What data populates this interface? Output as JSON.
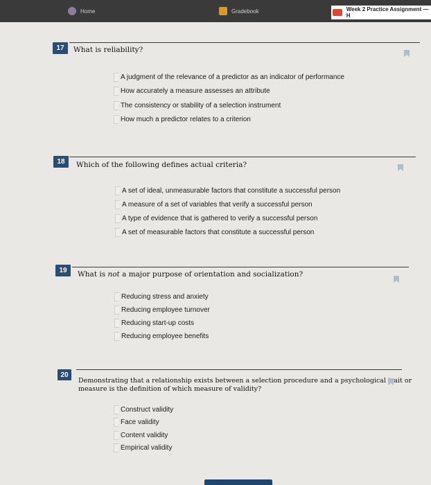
{
  "tabs": [
    {
      "label": "Home"
    },
    {
      "label": "Gradebook"
    },
    {
      "label": "Week 2 Practice Assignment — H"
    }
  ],
  "questions": [
    {
      "number": "17",
      "text": "What is reliability?",
      "options": [
        "A judgment of the relevance of a predictor as an indicator of performance",
        "How accurately a measure assesses an attribute",
        "The consistency or stability of a selection instrument",
        "How much a predictor relates to a criterion"
      ]
    },
    {
      "number": "18",
      "text": "Which of the following defines actual criteria?",
      "options": [
        "A set of ideal, unmeasurable factors that constitute a successful person",
        "A measure of a set of variables that verify a successful person",
        "A type of evidence that is gathered to verify a successful person",
        "A set of measurable factors that constitute a successful person"
      ]
    },
    {
      "number": "19",
      "text_parts": [
        "What is ",
        "not",
        " a major purpose of orientation and socialization?"
      ],
      "options": [
        "Reducing stress and anxiety",
        "Reducing employee turnover",
        "Reducing start-up costs",
        "Reducing employee benefits"
      ]
    },
    {
      "number": "20",
      "text_line1": "Demonstrating that a relationship exists between a selection procedure and a psychological trait or",
      "text_line2": "measure is the definition of which measure of validity?",
      "options": [
        "Construct validity",
        "Face validity",
        "Content validity",
        "Empirical validity"
      ]
    }
  ]
}
